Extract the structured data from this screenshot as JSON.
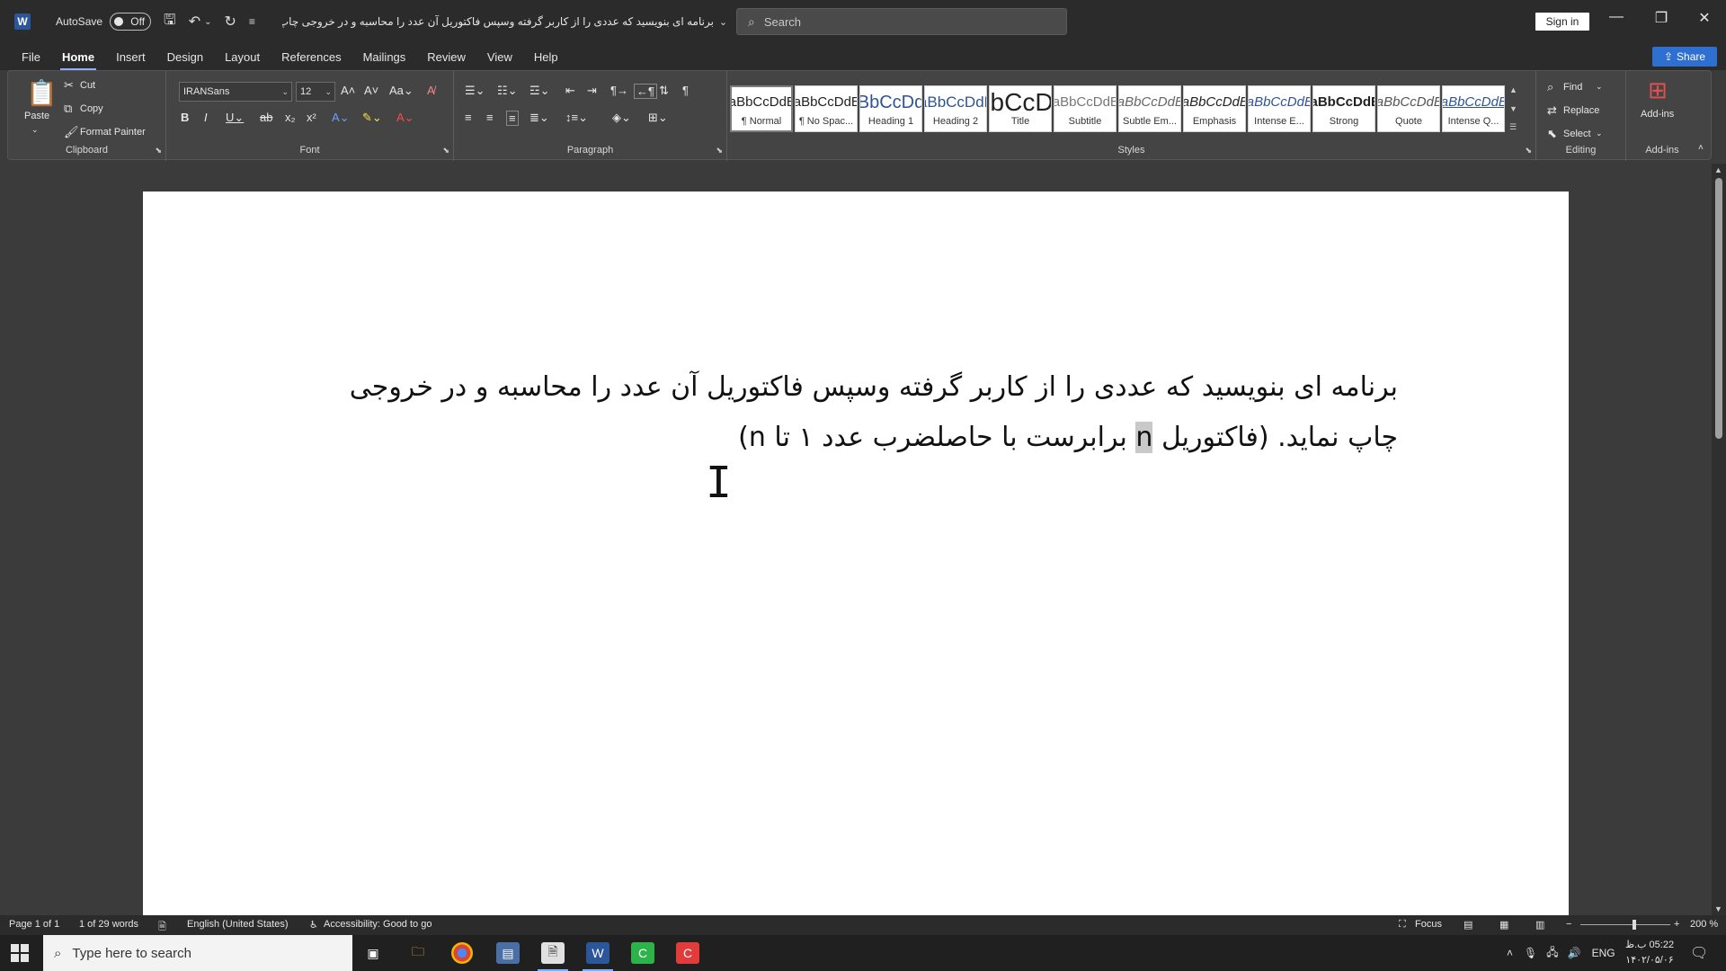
{
  "titlebar": {
    "autosave_label": "AutoSave",
    "autosave_state": "Off",
    "document_title": "برنامه ای بنویسید که عددی را از کاربر گرفته وسپس فاکتوریل آن عدد را محاسبه و در خروجی چاپ...",
    "search_placeholder": "Search",
    "sign_in_label": "Sign in"
  },
  "menu": {
    "tabs": [
      "File",
      "Home",
      "Insert",
      "Design",
      "Layout",
      "References",
      "Mailings",
      "Review",
      "View",
      "Help"
    ],
    "active": "Home",
    "share_label": "Share"
  },
  "ribbon": {
    "clipboard": {
      "paste": "Paste",
      "cut": "Cut",
      "copy": "Copy",
      "format_painter": "Format Painter",
      "label": "Clipboard"
    },
    "font": {
      "font_name": "IRANSans",
      "font_size": "12",
      "label": "Font"
    },
    "paragraph": {
      "label": "Paragraph"
    },
    "styles": {
      "label": "Styles",
      "tiles": [
        {
          "sample": "AaBbCcDdEe",
          "name": "¶ Normal"
        },
        {
          "sample": "AaBbCcDdEe",
          "name": "¶ No Spac..."
        },
        {
          "sample": "AaBbCcDdEe",
          "name": "Heading 1"
        },
        {
          "sample": "AaBbCcDdEe",
          "name": "Heading 2"
        },
        {
          "sample": "AaBbCcDdEe",
          "name": "Title"
        },
        {
          "sample": "AaBbCcDdEe",
          "name": "Subtitle"
        },
        {
          "sample": "AaBbCcDdEe",
          "name": "Subtle Em..."
        },
        {
          "sample": "AaBbCcDdEe",
          "name": "Emphasis"
        },
        {
          "sample": "AaBbCcDdEe",
          "name": "Intense E..."
        },
        {
          "sample": "AaBbCcDdEe",
          "name": "Strong"
        },
        {
          "sample": "AaBbCcDdEe",
          "name": "Quote"
        },
        {
          "sample": "AaBbCcDdEe",
          "name": "Intense Q..."
        }
      ]
    },
    "editing": {
      "find": "Find",
      "replace": "Replace",
      "select": "Select",
      "label": "Editing"
    },
    "addins": {
      "button": "Add-ins",
      "label": "Add-ins"
    }
  },
  "document": {
    "line1": "برنامه ای بنویسید که عددی را از کاربر گرفته وسپس فاکتوریل آن عدد را محاسبه و در خروجی",
    "line2_before": "چاپ نماید. (فاکتوریل ",
    "line2_selected": "n",
    "line2_after": " برابرست با حاصلضرب عدد ۱ تا n)"
  },
  "statusbar": {
    "page": "Page 1 of 1",
    "words": "1 of 29 words",
    "language": "English (United States)",
    "accessibility": "Accessibility: Good to go",
    "focus": "Focus",
    "zoom": "200 %"
  },
  "taskbar": {
    "search_placeholder": "Type here to search",
    "language": "ENG",
    "time": "05:22 ب.ظ",
    "date": "۱۴۰۲/۰۵/۰۶"
  }
}
